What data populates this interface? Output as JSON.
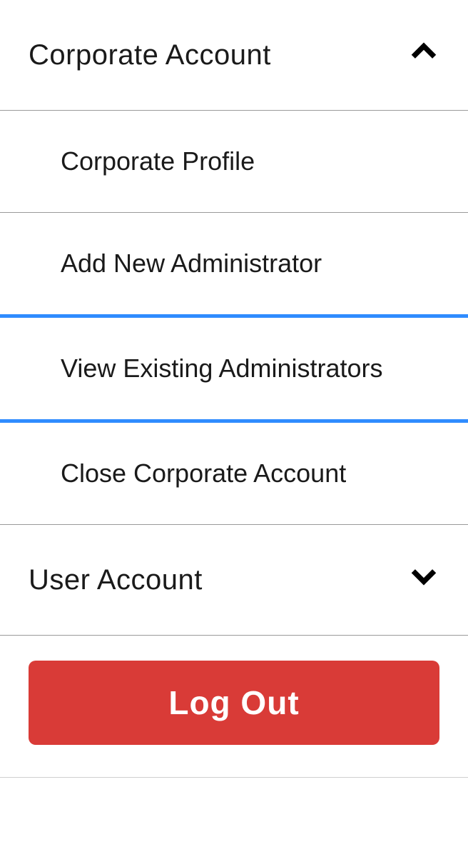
{
  "menu": {
    "sections": [
      {
        "label": "Corporate Account",
        "expanded": true,
        "items": [
          {
            "label": "Corporate Profile",
            "selected": false
          },
          {
            "label": "Add New Administrator",
            "selected": false
          },
          {
            "label": "View Existing Administrators",
            "selected": true
          },
          {
            "label": "Close Corporate Account",
            "selected": false
          }
        ]
      },
      {
        "label": "User Account",
        "expanded": false,
        "items": []
      }
    ]
  },
  "footer": {
    "logout_label": "Log Out"
  },
  "colors": {
    "accent": "#2f8cff",
    "danger": "#d93b37",
    "border": "#9a9a9a"
  }
}
